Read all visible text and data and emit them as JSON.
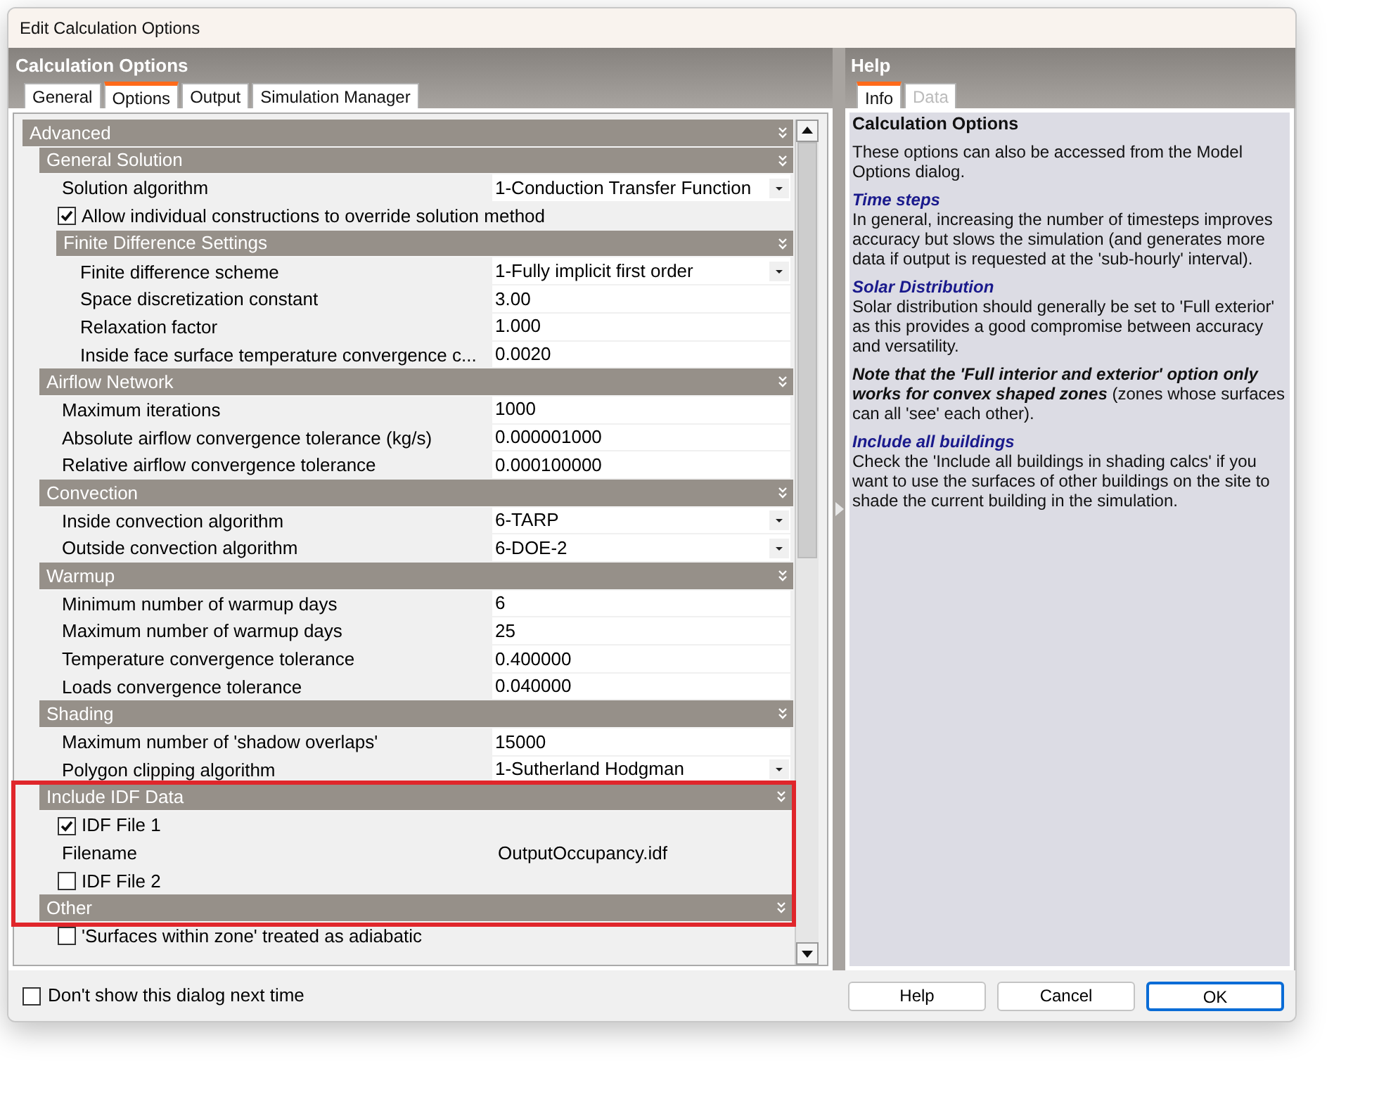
{
  "window": {
    "title": "Edit Calculation Options"
  },
  "options": {
    "title": "Calculation Options",
    "tabs": [
      {
        "label": "General",
        "selected": false
      },
      {
        "label": "Options",
        "selected": true
      },
      {
        "label": "Output",
        "selected": false
      },
      {
        "label": "Simulation Manager",
        "selected": false
      }
    ],
    "tree": [
      {
        "kind": "section",
        "label": "Advanced",
        "highlighted": false,
        "children": [
          {
            "kind": "section",
            "label": "General Solution",
            "highlighted": false,
            "children": [
              {
                "kind": "dropdown",
                "label": "Solution algorithm",
                "value": "1-Conduction Transfer Function",
                "highlighted": false
              },
              {
                "kind": "checkbox",
                "label": "Allow individual constructions to override solution method",
                "checked": true,
                "highlighted": false
              },
              {
                "kind": "section",
                "label": "Finite Difference Settings",
                "highlighted": false,
                "children": [
                  {
                    "kind": "dropdown",
                    "label": "Finite difference scheme",
                    "value": "1-Fully implicit first order",
                    "highlighted": false
                  },
                  {
                    "kind": "text",
                    "label": "Space discretization constant",
                    "value": "3.00",
                    "highlighted": false
                  },
                  {
                    "kind": "text",
                    "label": "Relaxation factor",
                    "value": "1.000",
                    "highlighted": false
                  },
                  {
                    "kind": "text",
                    "label": "Inside face surface temperature convergence c...",
                    "value": "0.0020",
                    "highlighted": false
                  }
                ]
              }
            ]
          },
          {
            "kind": "section",
            "label": "Airflow Network",
            "highlighted": false,
            "children": [
              {
                "kind": "text",
                "label": "Maximum iterations",
                "value": "1000",
                "highlighted": false
              },
              {
                "kind": "text",
                "label": "Absolute airflow convergence tolerance (kg/s)",
                "value": "0.000001000",
                "highlighted": false
              },
              {
                "kind": "text",
                "label": "Relative airflow convergence tolerance",
                "value": "0.000100000",
                "highlighted": false
              }
            ]
          },
          {
            "kind": "section",
            "label": "Convection",
            "highlighted": false,
            "children": [
              {
                "kind": "dropdown",
                "label": "Inside convection algorithm",
                "value": "6-TARP",
                "highlighted": false
              },
              {
                "kind": "dropdown",
                "label": "Outside convection algorithm",
                "value": "6-DOE-2",
                "highlighted": false
              }
            ]
          },
          {
            "kind": "section",
            "label": "Warmup",
            "highlighted": false,
            "children": [
              {
                "kind": "text",
                "label": "Minimum number of warmup days",
                "value": "6",
                "highlighted": false
              },
              {
                "kind": "text",
                "label": "Maximum number of warmup days",
                "value": "25",
                "highlighted": false
              },
              {
                "kind": "text",
                "label": "Temperature convergence tolerance",
                "value": "0.400000",
                "highlighted": false
              },
              {
                "kind": "text",
                "label": "Loads convergence tolerance",
                "value": "0.040000",
                "highlighted": false
              }
            ]
          },
          {
            "kind": "section",
            "label": "Shading",
            "highlighted": false,
            "children": [
              {
                "kind": "text",
                "label": "Maximum number of 'shadow overlaps'",
                "value": "15000",
                "highlighted": false
              },
              {
                "kind": "dropdown",
                "label": "Polygon clipping algorithm",
                "value": "1-Sutherland Hodgman",
                "highlighted": false
              }
            ]
          },
          {
            "kind": "section",
            "label": "Include IDF Data",
            "highlighted": true,
            "children": [
              {
                "kind": "checkbox",
                "label": "IDF File 1",
                "checked": true,
                "highlighted": true
              },
              {
                "kind": "static",
                "label": "Filename",
                "value": "OutputOccupancy.idf",
                "highlighted": true
              },
              {
                "kind": "checkbox",
                "label": "IDF File 2",
                "checked": false,
                "highlighted": true
              }
            ]
          },
          {
            "kind": "section",
            "label": "Other",
            "highlighted": true,
            "children": [
              {
                "kind": "checkbox",
                "label": "'Surfaces within zone' treated as adiabatic",
                "checked": false,
                "highlighted": false
              }
            ]
          }
        ]
      }
    ]
  },
  "help": {
    "title": "Help",
    "tabs": [
      {
        "label": "Info",
        "selected": true,
        "disabled": false
      },
      {
        "label": "Data",
        "selected": false,
        "disabled": true
      }
    ],
    "paragraphs": [
      {
        "kind": "title",
        "text": "Calculation Options"
      },
      {
        "kind": "text",
        "text": "These options can also be accessed from the Model Options dialog."
      },
      {
        "kind": "heading",
        "text": "Time steps"
      },
      {
        "kind": "body",
        "text": "In general, increasing the number of timesteps improves accuracy but slows the simulation (and generates more data if output is requested at the 'sub-hourly' interval)."
      },
      {
        "kind": "heading",
        "text": "Solar Distribution"
      },
      {
        "kind": "body",
        "text": "Solar distribution should generally be set to 'Full exterior' as this provides a good compromise between accuracy and versatility."
      },
      {
        "kind": "text",
        "text": "**Note that the 'Full interior and exterior' option only works for convex shaped zones** (zones whose surfaces can all 'see' each other)."
      },
      {
        "kind": "heading",
        "text": "Include all buildings"
      },
      {
        "kind": "body",
        "text": "Check the 'Include all buildings in shading calcs' if you want to use the surfaces of other buildings on the site to shade the current building in the simulation."
      }
    ]
  },
  "footer": {
    "dont_show": {
      "label": "Don't show this dialog next time",
      "checked": false
    },
    "buttons": [
      {
        "label": "Help",
        "default": false
      },
      {
        "label": "Cancel",
        "default": false
      },
      {
        "label": "OK",
        "default": true
      }
    ]
  }
}
